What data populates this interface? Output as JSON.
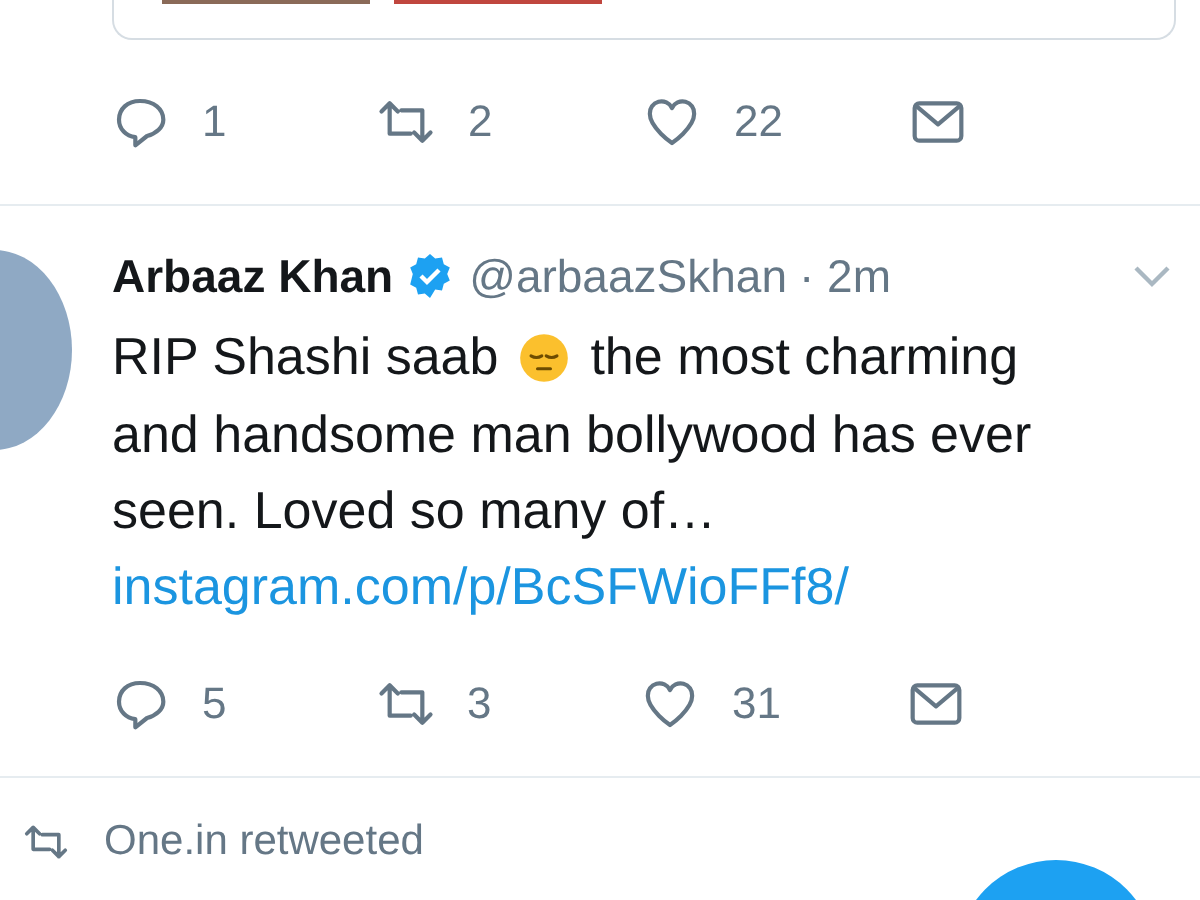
{
  "previous_tweet": {
    "actions": [
      {
        "kind": "reply",
        "count": "1"
      },
      {
        "kind": "retweet",
        "count": "2"
      },
      {
        "kind": "like",
        "count": "22"
      },
      {
        "kind": "message"
      }
    ]
  },
  "tweet": {
    "name": "Arbaaz Khan",
    "verified": true,
    "handle": "@arbaazSkhan",
    "time": "· 2m",
    "text_before": "RIP Shashi saab",
    "text_after": "the most charming",
    "text_rest": "and handsome man bollywood has ever seen. Loved so many of…",
    "link": "instagram.com/p/BcSFWioFFf8/",
    "actions": [
      {
        "kind": "reply",
        "count": "5"
      },
      {
        "kind": "retweet",
        "count": "3"
      },
      {
        "kind": "like",
        "count": "31"
      },
      {
        "kind": "message"
      }
    ]
  },
  "retweet_note": {
    "label": "One.in retweeted"
  }
}
